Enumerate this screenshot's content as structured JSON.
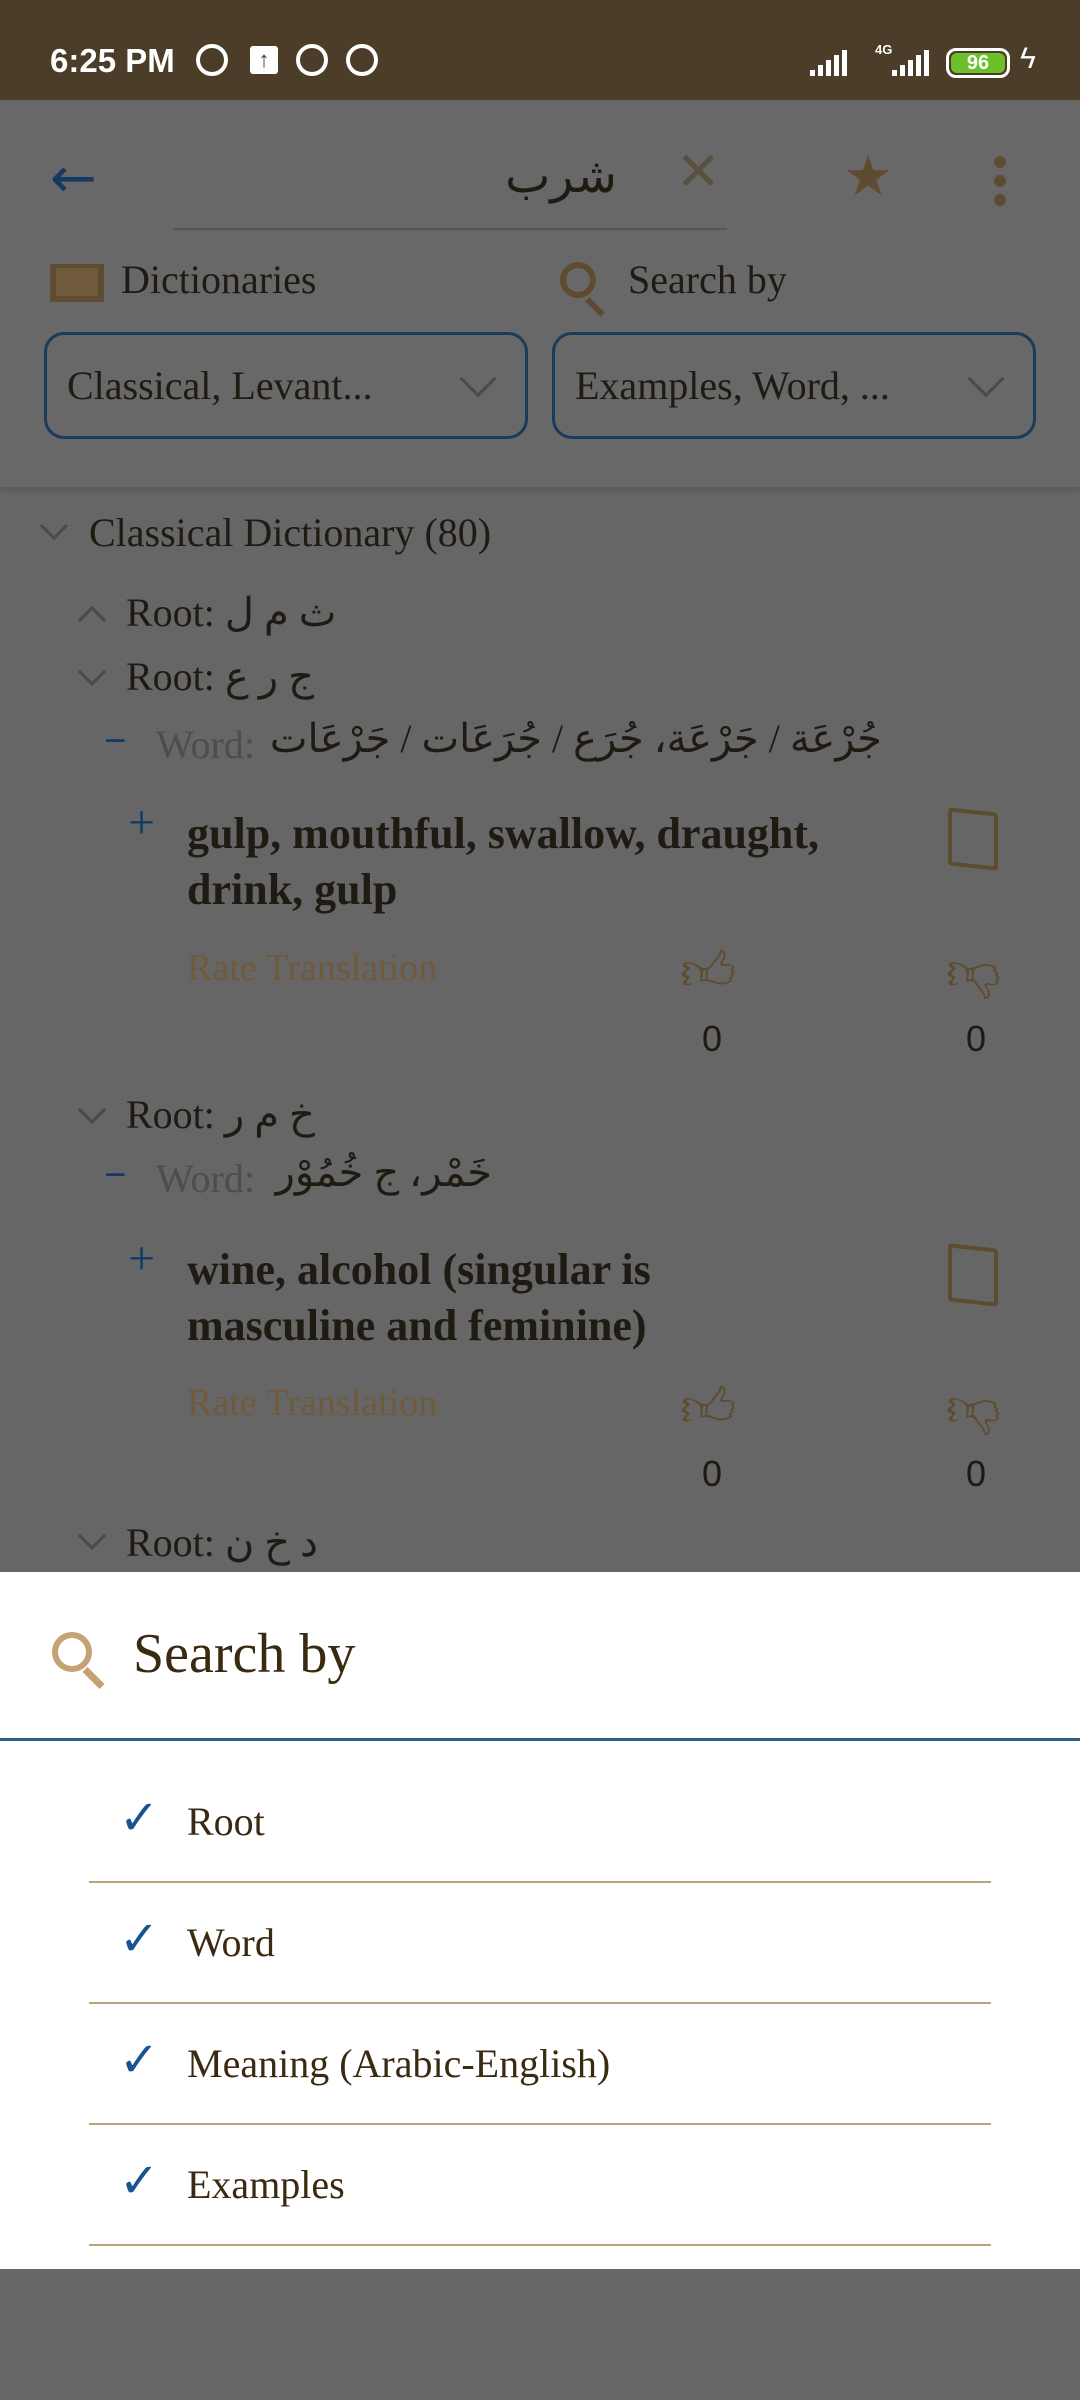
{
  "status_bar": {
    "time": "6:25 PM",
    "network": "4G",
    "battery": "96"
  },
  "search": {
    "query": "شرب"
  },
  "filters": {
    "dictionaries_label": "Dictionaries",
    "dictionaries_value": "Classical, Levant...",
    "search_by_label": "Search by",
    "search_by_value": "Examples, Word, ..."
  },
  "results": {
    "dictionary": "Classical Dictionary (80)",
    "roots": [
      {
        "label": "Root: ث م ل",
        "expanded": false
      },
      {
        "label": "Root: ج ر ع",
        "expanded": true,
        "word_label": "Word:",
        "word": "جُرْعَة / جَرْعَة، جُرَع / جُرَعَات / جَرْعَات",
        "meaning": "gulp, mouthful, swallow, draught, drink, gulp",
        "rate_label": "Rate Translation",
        "up": "0",
        "down": "0"
      },
      {
        "label": "Root: خ م ر",
        "expanded": true,
        "word_label": "Word:",
        "word": "خَمْر، ج خُمُوْر",
        "meaning": "wine, alcohol (singular is masculine and feminine)",
        "rate_label": "Rate Translation",
        "up": "0",
        "down": "0"
      },
      {
        "label": "Root: د خ ن",
        "expanded": true
      }
    ]
  },
  "sheet": {
    "title": "Search by",
    "options": [
      {
        "label": "Root",
        "checked": true
      },
      {
        "label": "Word",
        "checked": true
      },
      {
        "label": "Meaning (Arabic-English)",
        "checked": true
      },
      {
        "label": "Examples",
        "checked": true
      }
    ]
  },
  "colors": {
    "status_bar": "#4b3d28",
    "accent_blue": "#1a5490",
    "gold": "#a07a45",
    "text": "#2d1f0e"
  }
}
